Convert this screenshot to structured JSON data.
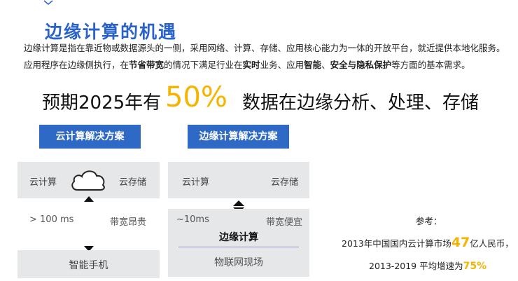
{
  "header": {
    "title": "边缘计算的机遇"
  },
  "intro": {
    "line1": "边缘计算是指在靠近物或数据源头的一侧，采用网络、计算、存储、应用核心能力为一体的开放平台，就近提供本地化服务。",
    "line2_a": "应用程序在边缘侧执行，在",
    "line2_b": "节省带宽",
    "line2_c": "的情况下满足行业在",
    "line2_d": "实时",
    "line2_e": "业务、应用",
    "line2_f": "智能",
    "line2_g": "、",
    "line2_h": "安全与隐私保护",
    "line2_i": "等方面的基本需求。"
  },
  "headline": {
    "left": "预期2025年有",
    "percent": "50%",
    "right": "数据在边缘分析、处理、存储"
  },
  "cloud_solution": {
    "button": "云计算解决方案",
    "compute": "云计算",
    "storage": "云存储",
    "latency": "> 100 ms",
    "bandwidth": "带宽昂贵",
    "device": "智能手机"
  },
  "edge_solution": {
    "button": "边缘计算解决方案",
    "compute": "云计算",
    "storage": "云存储",
    "latency": "~10ms",
    "bandwidth": "带宽便宜",
    "edge_label": "边缘计算",
    "iot": "物联网现场"
  },
  "reference": {
    "title": "参考：",
    "line1_pre": "2013年中国国内云计算市场",
    "line1_num": "47",
    "line1_post": "亿人民币，",
    "line2_pre": "2013-2019 平均增速为",
    "line2_num": "75%"
  },
  "colors": {
    "title_blue": "#2a63c8",
    "button_blue": "#2f69c6",
    "highlight_yellow": "#f4b400",
    "panel_gray": "#e6e7e9"
  }
}
